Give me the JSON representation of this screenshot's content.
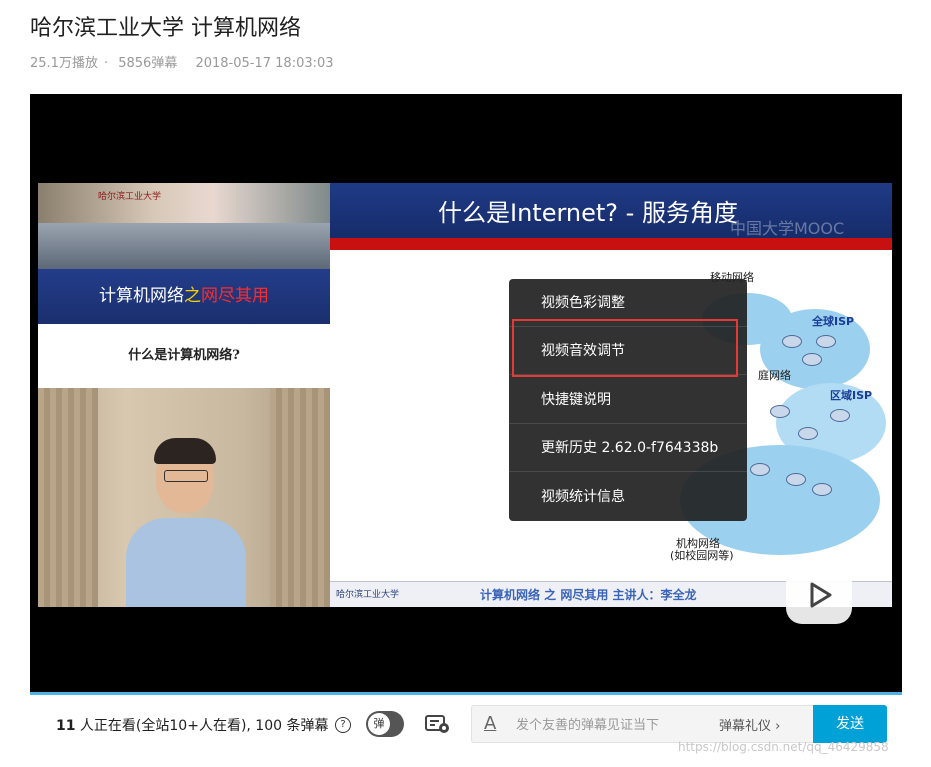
{
  "video": {
    "title": "哈尔滨工业大学 计算机网络",
    "plays": "25.1万播放",
    "sep": "·",
    "danmaku_count": "5856弹幕",
    "date": "2018-05-17 18:03:03"
  },
  "frame": {
    "left_logo": "哈尔滨工业大学",
    "band_part1": "计算机网络",
    "band_part2": "之",
    "band_part3": "网尽其用",
    "subtitle": "什么是计算机网络?",
    "slide_title": "什么是Internet? - 服务角度",
    "watermark": "中国大学MOOC",
    "footer_logo": "哈尔滨工业大学",
    "footer_text": "计算机网络 之 网尽其用    主讲人：李全龙",
    "net_labels": {
      "mobile": "移动网络",
      "global_isp": "全球ISP",
      "home": "庭网络",
      "regional_isp": "区域ISP",
      "institution": "机构网络",
      "campus": "(如校园网等)"
    }
  },
  "context_menu": {
    "items": [
      {
        "label": "视频色彩调整"
      },
      {
        "label": "视频音效调节"
      },
      {
        "label": "快捷键说明"
      },
      {
        "label": "更新历史 2.62.0-f764338b"
      },
      {
        "label": "视频统计信息"
      }
    ],
    "highlighted_index": 1,
    "highlight_color": "#e53935"
  },
  "controls": {
    "viewers_count": "11",
    "viewers_text": " 人正在看(全站10+人在看), 100 条弹幕",
    "help_icon": "?",
    "toggle_label": "弹",
    "danmaku_placeholder": "发个友善的弹幕见证当下",
    "etiquette": "弹幕礼仪 ›",
    "send": "发送",
    "accent": "#00a1d6"
  },
  "page_watermark": "https://blog.csdn.net/qq_46429858"
}
